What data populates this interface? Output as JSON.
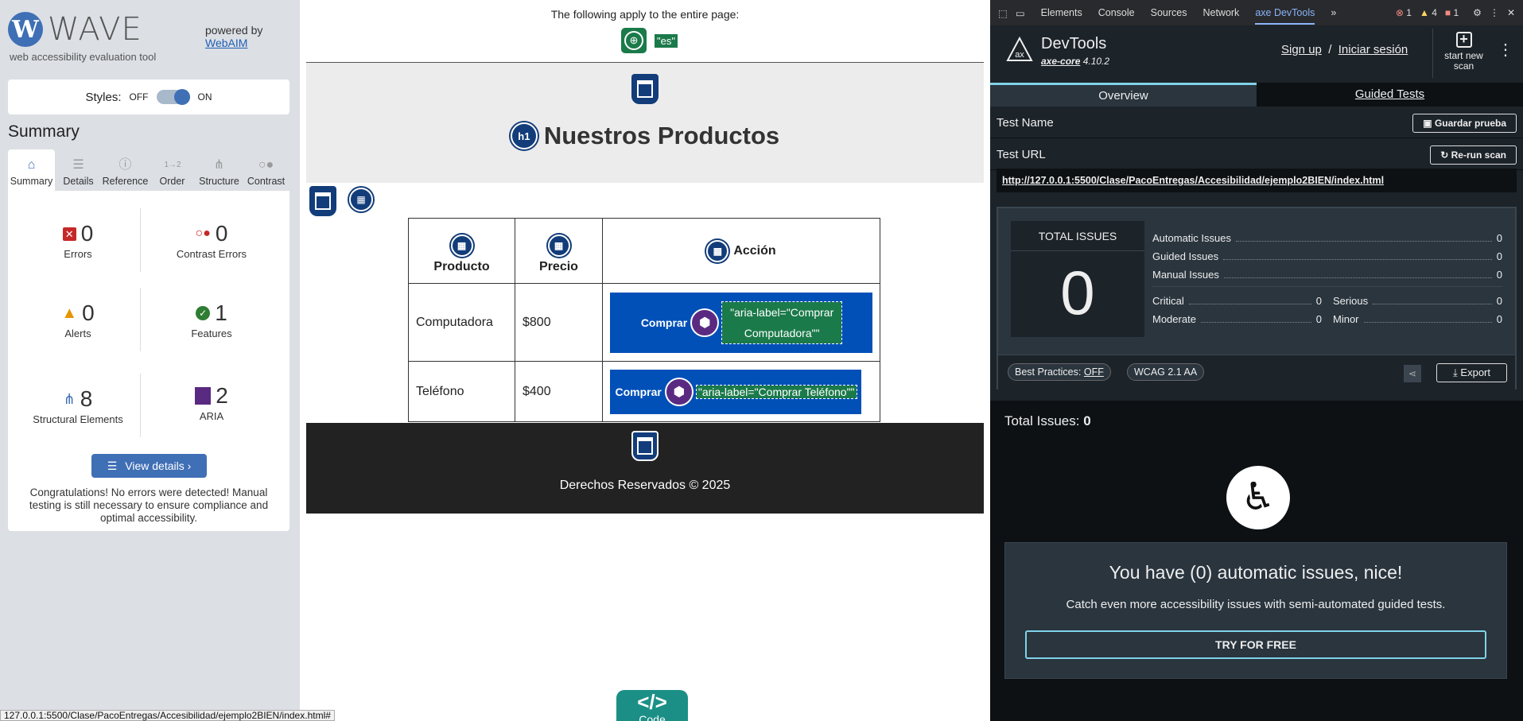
{
  "wave": {
    "logo": "WAVE",
    "subtitle": "web accessibility evaluation tool",
    "powered_by": "powered by",
    "webaim": "WebAIM",
    "styles_label": "Styles:",
    "off": "OFF",
    "on": "ON",
    "summary_title": "Summary",
    "tabs": [
      {
        "label": "Summary",
        "icon": "home-icon"
      },
      {
        "label": "Details",
        "icon": "list-icon"
      },
      {
        "label": "Reference",
        "icon": "info-icon"
      },
      {
        "label": "Order",
        "icon": "order-icon"
      },
      {
        "label": "Structure",
        "icon": "structure-icon"
      },
      {
        "label": "Contrast",
        "icon": "contrast-icon"
      }
    ],
    "stats": {
      "errors": {
        "value": "0",
        "label": "Errors"
      },
      "contrast": {
        "value": "0",
        "label": "Contrast Errors"
      },
      "alerts": {
        "value": "0",
        "label": "Alerts"
      },
      "features": {
        "value": "1",
        "label": "Features"
      },
      "structural": {
        "value": "8",
        "label": "Structural Elements"
      },
      "aria": {
        "value": "2",
        "label": "ARIA"
      }
    },
    "view_details": "View details ›",
    "congrats": "Congratulations! No errors were detected! Manual testing is still necessary to ensure compliance and optimal accessibility."
  },
  "page": {
    "applies": "The following apply to the entire page:",
    "lang": "\"es\"",
    "h1_badge": "h1",
    "heading": "Nuestros Productos",
    "table": {
      "headers": [
        "Producto",
        "Precio",
        "Acción"
      ],
      "rows": [
        {
          "product": "Computadora",
          "price": "$800",
          "button": "Comprar",
          "aria": "\"aria-label=\"Comprar Computadora\"\""
        },
        {
          "product": "Teléfono",
          "price": "$400",
          "button": "Comprar",
          "aria": "\"aria-label=\"Comprar Teléfono\"\""
        }
      ]
    },
    "footer": "Derechos Reservados © 2025",
    "code": "</>",
    "code_label": "Code",
    "status_url": "127.0.0.1:5500/Clase/PacoEntregas/Accesibilidad/ejemplo2BIEN/index.html#"
  },
  "devtools": {
    "tabs": [
      "Elements",
      "Console",
      "Sources",
      "Network",
      "axe DevTools"
    ],
    "errors": "1",
    "warnings": "4",
    "issues": "1",
    "title": "DevTools",
    "axe_core": "axe-core",
    "version": "4.10.2",
    "sign_up": "Sign up",
    "sep": "/",
    "sign_in": "Iniciar sesión",
    "new_scan": "start new scan",
    "tab_overview": "Overview",
    "tab_guided": "Guided Tests",
    "test_name": "Test Name",
    "save": "Guardar prueba",
    "test_url": "Test URL",
    "rerun": "Re-run scan",
    "url": "http://127.0.0.1:5500/Clase/PacoEntregas/Accesibilidad/ejemplo2BIEN/index.html",
    "total_issues_title": "TOTAL ISSUES",
    "total": "0",
    "automatic": "Automatic Issues",
    "automatic_v": "0",
    "guided": "Guided Issues",
    "guided_v": "0",
    "manual": "Manual Issues",
    "manual_v": "0",
    "critical": "Critical",
    "critical_v": "0",
    "serious": "Serious",
    "serious_v": "0",
    "moderate": "Moderate",
    "moderate_v": "0",
    "minor": "Minor",
    "minor_v": "0",
    "best_practices": "Best Practices:",
    "bp_value": "OFF",
    "wcag": "WCAG 2.1 AA",
    "export": "Export",
    "total_issues_label": "Total Issues:",
    "total_issues_value": "0",
    "nice_title": "You have (0) automatic issues, nice!",
    "nice_sub": "Catch even more accessibility issues with semi-automated guided tests.",
    "try": "TRY FOR FREE"
  },
  "colors": {
    "wave_blue": "#3f6fb5",
    "axe_accent": "#7fd3e8",
    "table_btn": "#0050b8",
    "wave_green": "#1b7a4a"
  }
}
